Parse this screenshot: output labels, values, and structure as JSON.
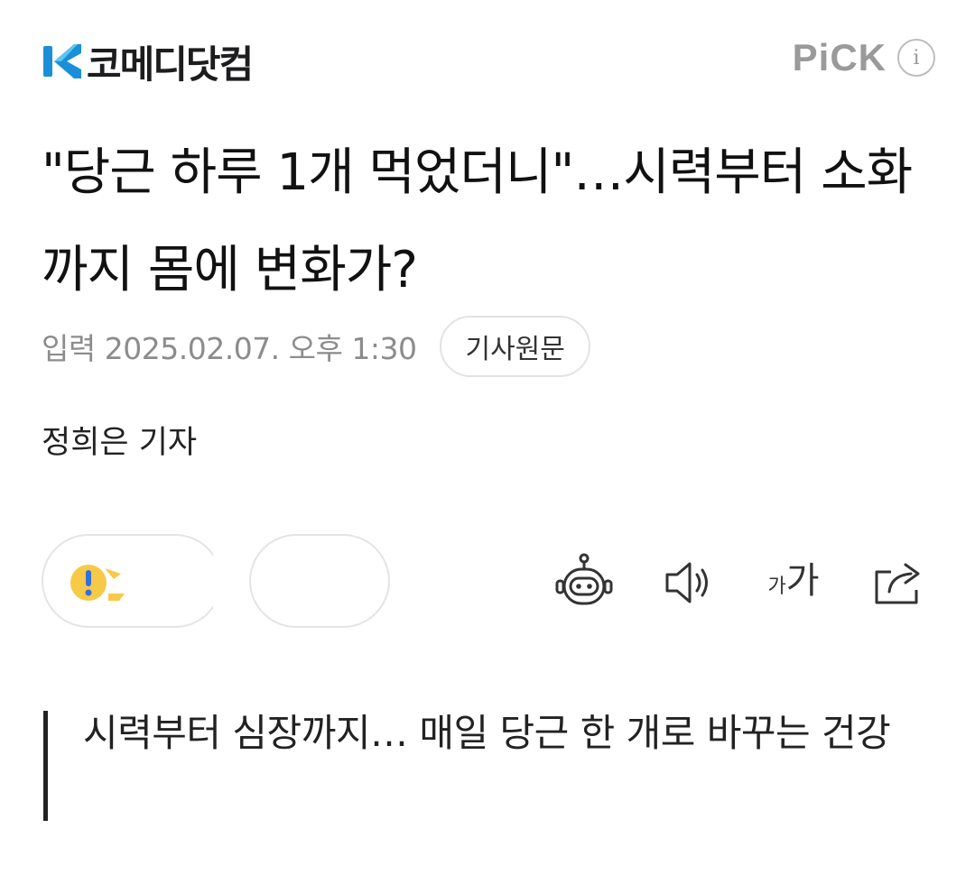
{
  "header": {
    "logo_text": "코메디닷컴",
    "pick_label": "PiCK",
    "pick_info_icon": "i"
  },
  "article": {
    "title": "\"당근 하루 1개 먹었더니\"…시력부터 소화까지 몸에 변화가?",
    "date_label": "입력",
    "date": "2025.02.07. 오후 1:30",
    "original_link": "기사원문",
    "reporter": "정희은 기자",
    "summary": "시력부터 심장까지… 매일 당근 한 개로 바꾸는 건강"
  },
  "reactions": {
    "icon": "reaction-emoji-icon"
  },
  "toolbar": {
    "summary_bot_icon": "robot-icon",
    "audio_icon": "speaker-icon",
    "font_small": "가",
    "font_large": "가",
    "share_icon": "share-icon"
  },
  "colors": {
    "logo_blue": "#1a8fd8",
    "pick_gray": "#9a9a9a",
    "meta_gray": "#8c8c8c",
    "reaction_yellow": "#f7c948",
    "reaction_blue": "#2f6fe4"
  }
}
